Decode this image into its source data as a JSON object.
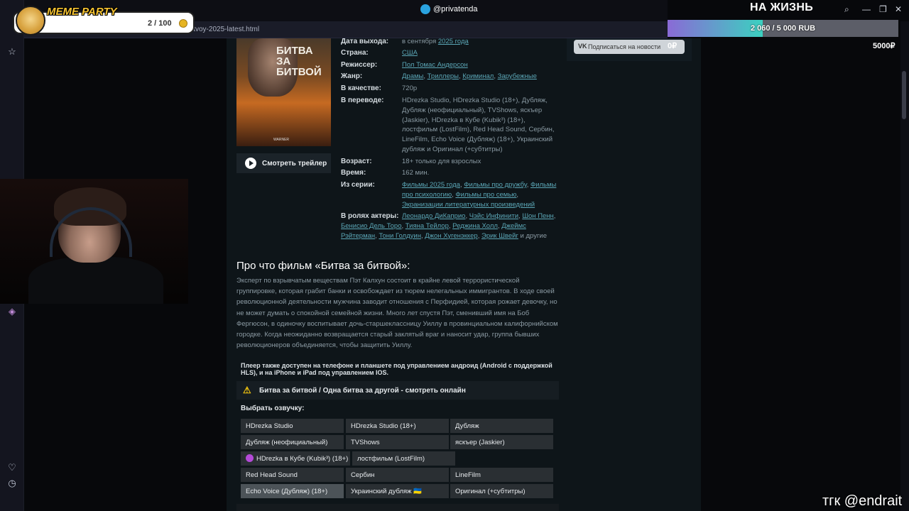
{
  "browser": {
    "address_text": "itvoy-2025-latest.html"
  },
  "stream": {
    "telegram_handle": "@privatenda",
    "top_right_title": "НА ЖИЗНЬ",
    "goal_text": "2 060 / 5 000 RUB",
    "goal_progress": 0.412,
    "goal_min": "5000₽",
    "meme_party_title": "MEME PARTY",
    "meme_party_count": "2 / 100",
    "watermark": "тгк @endrait",
    "vk_amount": "0₽"
  },
  "sidebar_right": {
    "vk_button": "Подписаться на новости",
    "vk_logo": "VK"
  },
  "poster": {
    "title": "БИТВА ЗА БИТВОЙ",
    "studio": "WARNER"
  },
  "trailer_button": "Смотреть трейлер",
  "info": {
    "release": {
      "label": "Дата выхода:",
      "value": "в сентября",
      "link": "2025 года"
    },
    "country": {
      "label": "Страна:",
      "link": "США"
    },
    "director": {
      "label": "Режиссер:",
      "link": "Пол Томас Андерсон"
    },
    "genre": {
      "label": "Жанр:",
      "links": [
        "Драмы",
        "Триллеры",
        "Криминал",
        "Зарубежные"
      ]
    },
    "quality": {
      "label": "В качестве:",
      "value": "720p"
    },
    "translation": {
      "label": "В переводе:",
      "value": "HDrezka Studio, HDrezka Studio (18+), Дубляж, Дубляж (неофициальный), TVShows, яскъер (Jaskier), HDrezka в Кубе (Kubik³) (18+), лостфильм (LostFilm), Red Head Sound, Сербин, LineFilm, Echo Voice (Дубляж) (18+), Украинский дубляж и Оригинал (+субтитры)"
    },
    "age": {
      "label": "Возраст:",
      "value": "18+ только для взрослых"
    },
    "time": {
      "label": "Время:",
      "value": "162 мин."
    },
    "series": {
      "label": "Из серии:",
      "links": [
        "Фильмы 2025 года",
        "Фильмы про дружбу",
        "Фильмы про психологию",
        "Фильмы про семью",
        "Экранизации литературных произведений"
      ]
    },
    "cast": {
      "label": "В ролях актеры:",
      "links": [
        "Леонардо ДиКаприо",
        "Чэйс Инфинити",
        "Шон Пенн",
        "Бенисио Дель Торо",
        "Тияна Тейлор",
        "Реджина Холл",
        "Джеймс Рэйтерман",
        "Тони Голдуин",
        "Джон Хугенэккер",
        "Эрик Швейг"
      ],
      "more": "и другие"
    }
  },
  "about": {
    "title": "Про что фильм «Битва за битвой»:",
    "text": "Эксперт по взрывчатым веществам Пэт Калхун состоит в крайне левой террористической группировке, которая грабит банки и освобождает из тюрем нелегальных иммигрантов. В ходе своей революционной деятельности мужчина заводит отношения с Перфидией, которая рожает девочку, но не может думать о спокойной семейной жизни. Много лет спустя Пэт, сменивший имя на Боб Фергюсон, в одиночку воспитывает дочь-старшеклассницу Уиллу в провинциальном калифорнийском городке. Когда неожиданно возвращается старый заклятый враг и наносит удар, группа бывших революционеров объединяется, чтобы защитить Уиллу."
  },
  "player": {
    "note": "Плеер также доступен на телефоне и планшете под управлением андроид (Android с поддержкой HLS), и на iPhone и iPad под управлением IOS.",
    "warning_title": "Битва за битвой / Одна битва за другой - смотреть онлайн",
    "voice_label": "Выбрать озвучку:",
    "voices": [
      "HDrezka Studio",
      "HDrezka Studio (18+)",
      "Дубляж",
      "Дубляж (неофициальный)",
      "TVShows",
      "яскъер (Jaskier)",
      "HDrezka в Кубе (Kubik³) (18+)",
      "лостфильм (LostFilm)",
      "Red Head Sound",
      "Сербин",
      "LineFilm",
      "Echo Voice (Дубляж) (18+)",
      "Украинский дубляж 🇺🇦",
      "Оригинал (+субтитры)"
    ]
  }
}
